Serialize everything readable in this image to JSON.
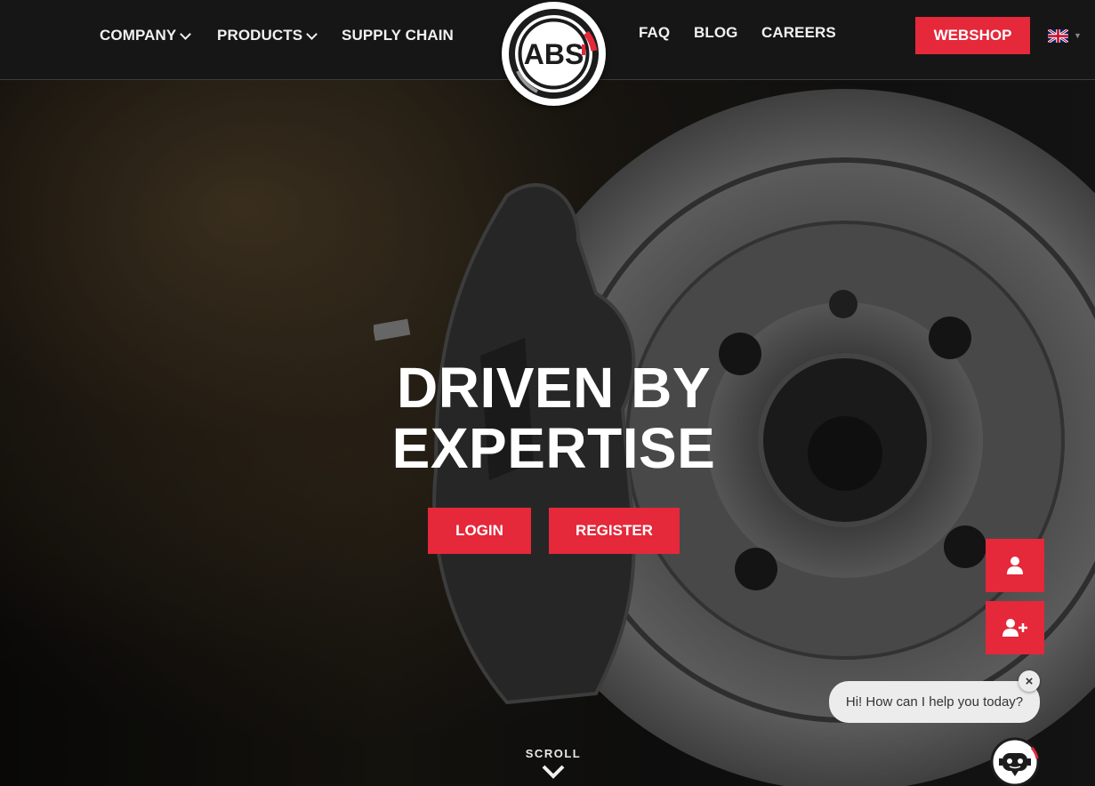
{
  "nav": {
    "left": [
      {
        "label": "COMPANY",
        "dropdown": true
      },
      {
        "label": "PRODUCTS",
        "dropdown": true
      },
      {
        "label": "SUPPLY CHAIN",
        "dropdown": false
      }
    ],
    "right": [
      {
        "label": "FAQ"
      },
      {
        "label": "BLOG"
      },
      {
        "label": "CAREERS"
      }
    ],
    "logo_text": "ABS",
    "webshop_label": "WEBSHOP",
    "language_icon": "uk-flag-icon"
  },
  "hero": {
    "headline_line1": "DRIVEN BY",
    "headline_line2": "EXPERTISE",
    "login_label": "LOGIN",
    "register_label": "REGISTER",
    "scroll_label": "SCROLL"
  },
  "side_actions": [
    {
      "icon": "user-icon"
    },
    {
      "icon": "user-plus-icon"
    }
  ],
  "chat": {
    "greeting": "Hi! How can I help you today?",
    "close_label": "×",
    "avatar_icon": "chatbot-icon"
  },
  "colors": {
    "accent": "#e5283a",
    "nav_bg": "#161616",
    "text": "#ffffff"
  }
}
